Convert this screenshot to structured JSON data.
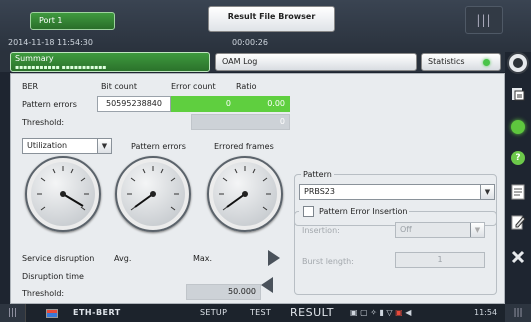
{
  "topbar": {
    "port_tab": "Port 1",
    "file_browser": "Result File Browser",
    "timestamp": "2014-11-18 11:54:30",
    "elapsed": "00:00:26",
    "menu_handle": "|||"
  },
  "tabs": {
    "summary": "Summary",
    "summary_dots": "▪▪▪▪▪▪▪▪▪▪▪       ▪▪▪▪▪▪▪▪▪▪▪",
    "oam_log": "OAM Log",
    "statistics": "Statistics"
  },
  "ber": {
    "title": "BER",
    "col_bit_count": "Bit count",
    "col_error_count": "Error count",
    "col_ratio": "Ratio",
    "row_pattern_errors": "Pattern errors",
    "bit_count": "50595238840",
    "error_count": "0",
    "ratio": "0.00",
    "row_threshold": "Threshold:",
    "threshold_value": "0"
  },
  "gauges": {
    "selector": "Utilization",
    "label_pattern_errors": "Pattern errors",
    "label_errored_frames": "Errored frames"
  },
  "disruption": {
    "service_disruption": "Service disruption",
    "avg": "Avg.",
    "max": "Max.",
    "disruption_time": "Disruption time",
    "threshold_label": "Threshold:",
    "threshold_value": "50.000"
  },
  "pattern": {
    "legend": "Pattern",
    "value": "PRBS23",
    "pei_legend": "Pattern Error Insertion",
    "insertion_label": "Insertion:",
    "insertion_value": "Off",
    "burst_label": "Burst length:",
    "burst_value": "1"
  },
  "bottombar": {
    "app_name": "ETH-BERT",
    "setup": "SETUP",
    "test": "TEST",
    "result": "RESULT",
    "clock": "11:54"
  },
  "colors": {
    "accent_green": "#5fcf3f",
    "tab_green": "#3e9a3e",
    "dark_bg": "#1e2530"
  }
}
